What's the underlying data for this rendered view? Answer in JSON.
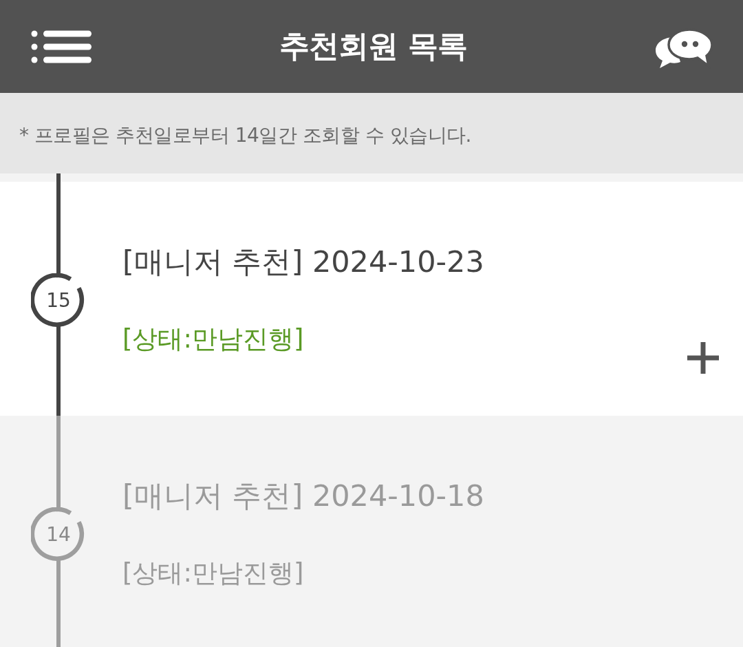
{
  "header": {
    "title": "추천회원 목록"
  },
  "notice": "* 프로필은 추천일로부터 14일간 조회할 수 있습니다.",
  "recommendations": [
    {
      "number": "15",
      "title": "[매니저 추천] 2024-10-23",
      "status": "[상태:만남진행]",
      "active": true,
      "expandable": true
    },
    {
      "number": "14",
      "title": "[매니저 추천] 2024-10-18",
      "status": "[상태:만남진행]",
      "active": false,
      "expandable": false
    }
  ]
}
